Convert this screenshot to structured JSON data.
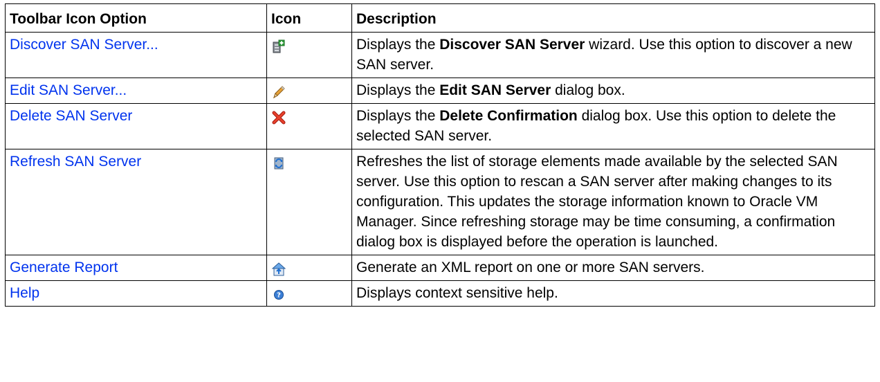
{
  "table": {
    "headers": [
      "Toolbar Icon Option",
      "Icon",
      "Description"
    ],
    "rows": [
      {
        "option": "Discover SAN Server...",
        "icon": "discover-server-icon",
        "desc_before": "Displays the ",
        "desc_bold": "Discover SAN Server",
        "desc_after": " wizard. Use this option to discover a new SAN server."
      },
      {
        "option": "Edit SAN Server...",
        "icon": "pencil-icon",
        "desc_before": "Displays the ",
        "desc_bold": "Edit SAN Server",
        "desc_after": " dialog box."
      },
      {
        "option": "Delete SAN Server",
        "icon": "red-x-icon",
        "desc_before": "Displays the ",
        "desc_bold": "Delete Confirmation",
        "desc_after": " dialog box. Use this option to delete the selected SAN server."
      },
      {
        "option": "Refresh SAN Server",
        "icon": "refresh-icon",
        "desc": "Refreshes the list of storage elements made available by the selected SAN server. Use this option to rescan a SAN server after making changes to its configuration. This updates the storage information known to Oracle VM Manager. Since refreshing storage may be time consuming, a confirmation dialog box is displayed before the operation is launched."
      },
      {
        "option": "Generate Report",
        "icon": "report-icon",
        "desc": "Generate an XML report on one or more SAN servers."
      },
      {
        "option": "Help",
        "icon": "help-icon",
        "desc": "Displays context sensitive help."
      }
    ]
  },
  "colors": {
    "link": "#0033ee",
    "border": "#000000"
  }
}
